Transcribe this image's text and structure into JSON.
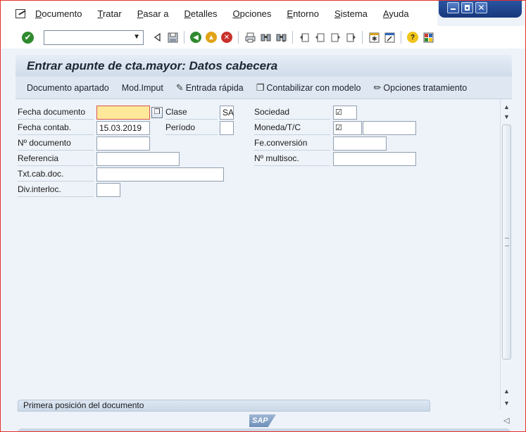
{
  "menubar": {
    "items": [
      {
        "label": "Documento",
        "ul": "D",
        "rest": "ocumento"
      },
      {
        "label": "Tratar",
        "ul": "T",
        "rest": "ratar"
      },
      {
        "label": "Pasar a",
        "ul": "P",
        "rest": "asar a"
      },
      {
        "label": "Detalles",
        "ul": "D",
        "rest": "etalles"
      },
      {
        "label": "Opciones",
        "ul": "O",
        "rest": "pciones"
      },
      {
        "label": "Entorno",
        "ul": "E",
        "rest": "ntorno"
      },
      {
        "label": "Sistema",
        "ul": "S",
        "rest": "istema"
      },
      {
        "label": "Ayuda",
        "ul": "A",
        "rest": "yuda"
      }
    ]
  },
  "toolbar": {
    "command_value": ""
  },
  "title": "Entrar apunte de cta.mayor: Datos cabecera",
  "app_toolbar": {
    "documento_apartado": "Documento apartado",
    "mod_imput": "Mod.Imput",
    "entrada_rapida": "Entrada rápida",
    "contabilizar_con_modelo": "Contabilizar con modelo",
    "opciones_tratamiento": "Opciones tratamiento"
  },
  "form": {
    "fecha_documento": {
      "label": "Fecha documento",
      "value": ""
    },
    "fecha_contab": {
      "label": "Fecha contab.",
      "value": "15.03.2019"
    },
    "n_documento": {
      "label": "Nº documento",
      "value": ""
    },
    "referencia": {
      "label": "Referencia",
      "value": ""
    },
    "txt_cab_doc": {
      "label": "Txt.cab.doc.",
      "value": ""
    },
    "div_interloc": {
      "label": "Div.interloc.",
      "value": ""
    },
    "clase": {
      "label": "Clase",
      "value": "SA"
    },
    "periodo": {
      "label": "Período",
      "value": ""
    },
    "sociedad": {
      "label": "Sociedad",
      "value": "☑"
    },
    "moneda_tc": {
      "label": "Moneda/T/C",
      "value": "☑",
      "tc_value": ""
    },
    "fe_conversion": {
      "label": "Fe.conversión",
      "value": ""
    },
    "n_multisoc": {
      "label": "Nº multisoc.",
      "value": ""
    }
  },
  "status": "Primera posición del documento",
  "logo_text": "SAP",
  "colors": {
    "accent_red": "#e5312b",
    "required_field": "#fde999",
    "background": "#eef3f9"
  }
}
